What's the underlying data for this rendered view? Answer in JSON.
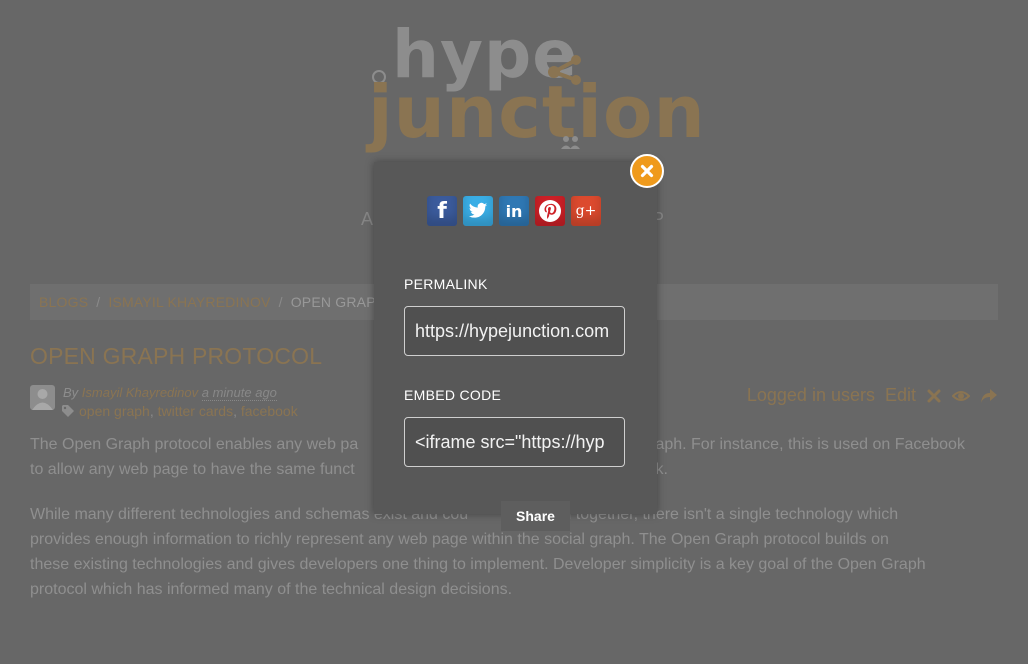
{
  "site": {
    "logo_top": "hype",
    "logo_bottom": "junction",
    "tagline_left_fragment": "A",
    "tagline_right_fragment": "P"
  },
  "breadcrumb": {
    "items": [
      "BLOGS",
      "ISMAYIL KHAYREDINOV"
    ],
    "separator": "/",
    "current": "OPEN GRAPH"
  },
  "post": {
    "title": "OPEN GRAPH PROTOCOL",
    "by_label": "By",
    "author": "Ismayil Khayredinov",
    "time_ago": "a minute ago",
    "tags": [
      "open graph",
      "twitter cards",
      "facebook"
    ],
    "actions": {
      "access": "Logged in users",
      "edit": "Edit"
    },
    "paragraphs": [
      {
        "line1_start": "The Open Graph protocol enables any web pa",
        "line1_end": "graph. For instance, this is used on Facebook",
        "line2_start": "to allow any web page to have the same funct",
        "line2_end": "ook."
      },
      {
        "line1_start": "While many different technologies and schemas exist and cou",
        "line1_end": "bined together, there isn't a single technology which",
        "line2": "provides enough information to richly represent any web page within the social graph. The Open Graph protocol builds on",
        "line3": "these existing technologies and gives developers one thing to implement. Developer simplicity is a key goal of the Open Graph",
        "line4": "protocol which has informed many of the technical design decisions."
      }
    ]
  },
  "share_modal": {
    "social": [
      {
        "name": "facebook",
        "glyph": "f",
        "color": "#3b5b9c"
      },
      {
        "name": "twitter",
        "glyph": "",
        "color": "#3aaee6"
      },
      {
        "name": "linkedin",
        "glyph": "in",
        "color": "#2f78b4"
      },
      {
        "name": "pinterest",
        "glyph": "",
        "color": "#cd2027"
      },
      {
        "name": "google-plus",
        "glyph": "g+",
        "color": "#dc4a2e"
      }
    ],
    "permalink_label": "PERMALINK",
    "permalink_value": "https://hypejunction.com",
    "embed_label": "EMBED CODE",
    "embed_value": "<iframe src=\"https://hyp",
    "title": "Share",
    "close_color": "#ef9a1c"
  }
}
